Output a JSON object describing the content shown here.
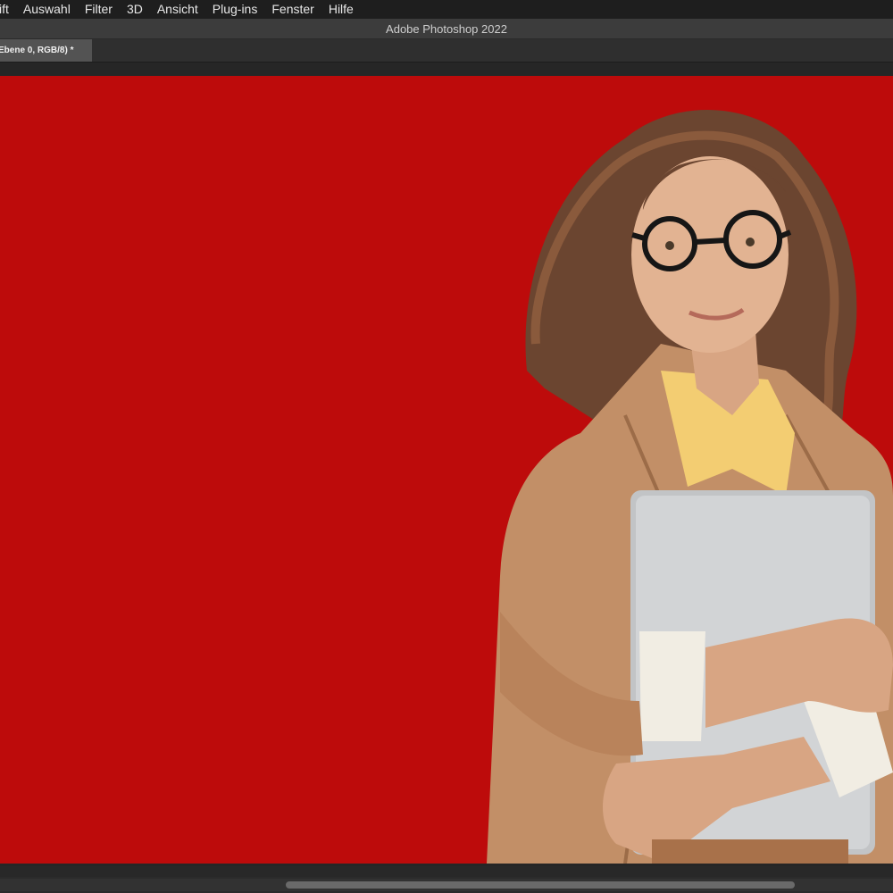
{
  "menubar": {
    "items": [
      {
        "label": "ift"
      },
      {
        "label": "Auswahl"
      },
      {
        "label": "Filter"
      },
      {
        "label": "3D"
      },
      {
        "label": "Ansicht"
      },
      {
        "label": "Plug-ins"
      },
      {
        "label": "Fenster"
      },
      {
        "label": "Hilfe"
      }
    ]
  },
  "window": {
    "title": "Adobe Photoshop 2022"
  },
  "document_tab": {
    "label": "Ebene 0, RGB/8) *"
  },
  "canvas": {
    "background_color": "#bd0b0b",
    "subject": "photo-person-holding-laptop"
  },
  "colors": {
    "menubar_bg": "#1e1e1e",
    "titlebar_bg": "#3c3c3c",
    "tab_bg": "#535353",
    "workspace_bg": "#262626",
    "canvas_red": "#bd0b0b"
  }
}
